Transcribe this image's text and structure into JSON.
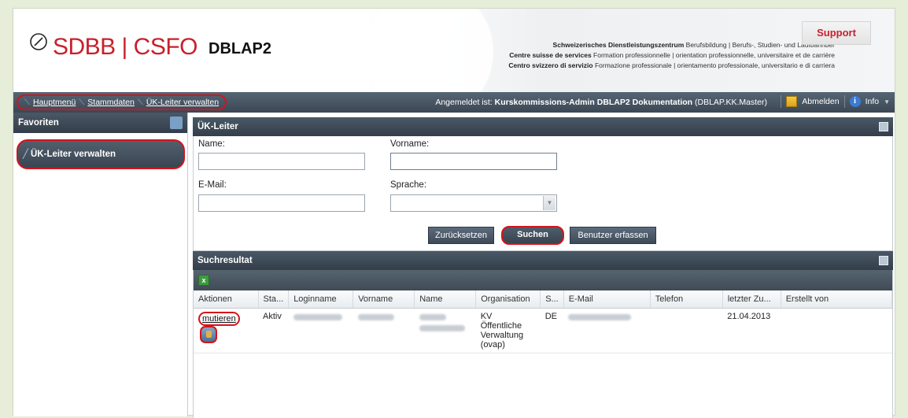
{
  "header": {
    "brand": "SDBB | CSFO",
    "app_name": "DBLAP2",
    "support_label": "Support",
    "tagline": [
      {
        "bold": "Schweizerisches Dienstleistungszentrum",
        "rest": " Berufsbildung | Berufs-, Studien- und Laufbahnber"
      },
      {
        "bold": "Centre suisse de services",
        "rest": " Formation professionnelle | orientation professionnelle, universitaire et de carrière"
      },
      {
        "bold": "Centro svizzero di servizio",
        "rest": " Formazione professionale | orientamento professionale, universitario e di carriera"
      }
    ]
  },
  "navbar": {
    "breadcrumbs": [
      "Hauptmenü",
      "Stammdaten",
      "ÜK-Leiter verwalten"
    ],
    "login_prefix": "Angemeldet ist: ",
    "login_user": "Kurskommissions-Admin DBLAP2 Dokumentation",
    "login_suffix": " (DBLAP.KK.Master)",
    "logout_label": "Abmelden",
    "info_label": "Info"
  },
  "sidebar": {
    "title": "Favoriten",
    "items": [
      {
        "label": "ÜK-Leiter verwalten"
      }
    ]
  },
  "search": {
    "title": "ÜK-Leiter",
    "name_label": "Name:",
    "vorname_label": "Vorname:",
    "email_label": "E-Mail:",
    "sprache_label": "Sprache:",
    "name_value": "",
    "vorname_value": "",
    "email_value": "",
    "sprache_value": "",
    "reset_label": "Zurücksetzen",
    "search_label": "Suchen",
    "add_label": "Benutzer erfassen"
  },
  "results": {
    "title": "Suchresultat",
    "columns": [
      "Aktionen",
      "Sta...",
      "Loginname",
      "Vorname",
      "Name",
      "Organisation",
      "S...",
      "E-Mail",
      "Telefon",
      "letzter Zu...",
      "Erstellt von"
    ],
    "rows": [
      {
        "action": "mutieren",
        "status": "Aktiv",
        "organisation": [
          "KV",
          "Öffentliche",
          "Verwaltung",
          "(ovap)"
        ],
        "sprache": "DE",
        "telefon": "",
        "letzter_zugriff": "21.04.2013",
        "erstellt_von": ""
      }
    ]
  }
}
